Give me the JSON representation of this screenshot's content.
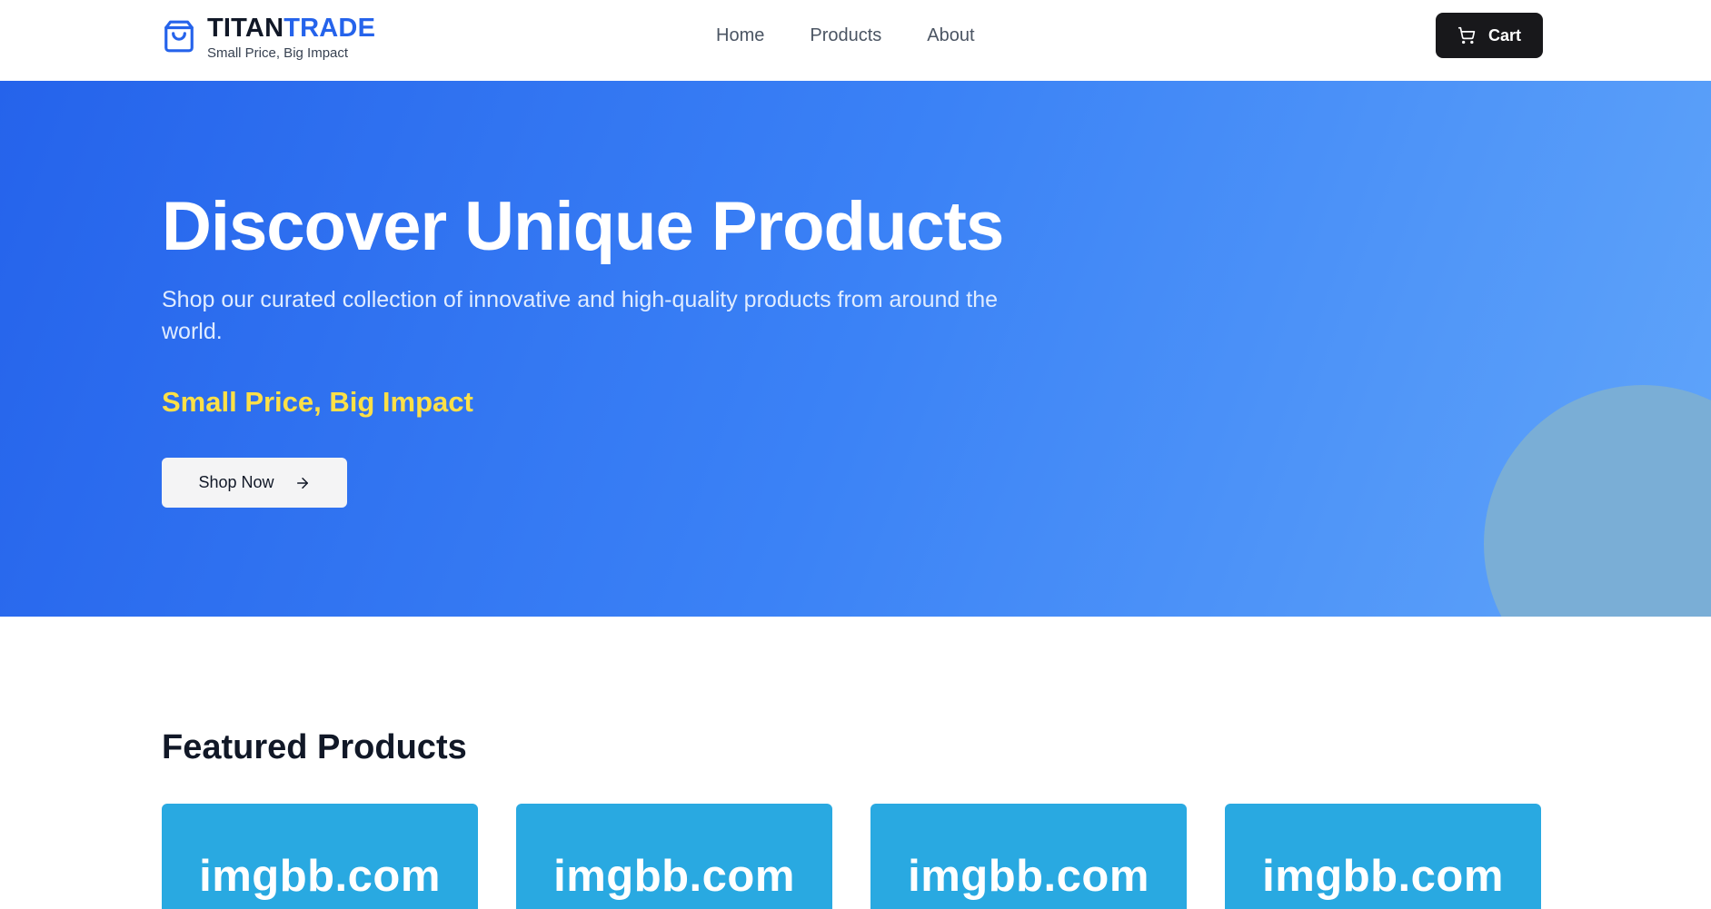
{
  "brand": {
    "name_part1": "TITAN",
    "name_part2": "TRADE",
    "tagline": "Small Price, Big Impact",
    "icon": "shopping-bag-icon",
    "accent_color": "#2563eb"
  },
  "nav": {
    "items": [
      {
        "label": "Home"
      },
      {
        "label": "Products"
      },
      {
        "label": "About"
      }
    ]
  },
  "cart": {
    "label": "Cart",
    "icon": "cart-icon"
  },
  "hero": {
    "title": "Discover Unique Products",
    "subtitle": "Shop our curated collection of innovative and high-quality products from around the world.",
    "tagline": "Small Price, Big Impact",
    "cta_label": "Shop Now",
    "cta_icon": "arrow-right-icon",
    "gradient_start": "#2563eb",
    "gradient_end": "#60a5fa",
    "tagline_color": "#fde047"
  },
  "featured": {
    "title": "Featured Products",
    "products": [
      {
        "image_text": "imgbb.com"
      },
      {
        "image_text": "imgbb.com"
      },
      {
        "image_text": "imgbb.com"
      },
      {
        "image_text": "imgbb.com"
      }
    ],
    "placeholder_color": "#29a9e1"
  }
}
